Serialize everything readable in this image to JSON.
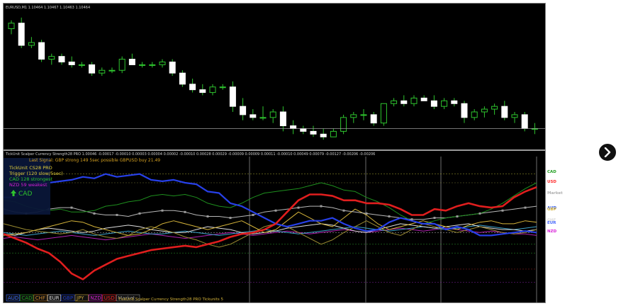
{
  "chart": {
    "symbol_header": "EURUSD,M1  1.10464 1.10467 1.10463 1.10464",
    "price_candles": [
      [
        1.1062,
        1.1065,
        1.106,
        1.1064
      ],
      [
        1.1064,
        1.1066,
        1.1055,
        1.1056
      ],
      [
        1.1056,
        1.1059,
        1.1055,
        1.1057
      ],
      [
        1.1057,
        1.1058,
        1.105,
        1.1051
      ],
      [
        1.1051,
        1.1053,
        1.1049,
        1.1052
      ],
      [
        1.1052,
        1.1053,
        1.1049,
        1.105
      ],
      [
        1.105,
        1.1052,
        1.1048,
        1.1049
      ],
      [
        1.1049,
        1.105,
        1.1048,
        1.1049
      ],
      [
        1.1049,
        1.105,
        1.1045,
        1.1046
      ],
      [
        1.1046,
        1.1048,
        1.1045,
        1.1047
      ],
      [
        1.1047,
        1.1048,
        1.1046,
        1.1047
      ],
      [
        1.1047,
        1.1052,
        1.1046,
        1.1051
      ],
      [
        1.1051,
        1.1053,
        1.1049,
        1.1049
      ],
      [
        1.1049,
        1.105,
        1.1048,
        1.1049
      ],
      [
        1.1049,
        1.105,
        1.1048,
        1.1049
      ],
      [
        1.1049,
        1.1051,
        1.1048,
        1.105
      ],
      [
        1.105,
        1.1051,
        1.1045,
        1.1046
      ],
      [
        1.1046,
        1.1047,
        1.1041,
        1.1042
      ],
      [
        1.1042,
        1.1044,
        1.1039,
        1.104
      ],
      [
        1.104,
        1.1042,
        1.1038,
        1.1039
      ],
      [
        1.1039,
        1.1042,
        1.1038,
        1.1041
      ],
      [
        1.1041,
        1.1042,
        1.104,
        1.1041
      ],
      [
        1.1041,
        1.1043,
        1.1032,
        1.1034
      ],
      [
        1.1034,
        1.1037,
        1.1029,
        1.1031
      ],
      [
        1.1031,
        1.1033,
        1.1029,
        1.103
      ],
      [
        1.103,
        1.1034,
        1.1029,
        1.103
      ],
      [
        1.103,
        1.1033,
        1.1028,
        1.1032
      ],
      [
        1.1032,
        1.1034,
        1.1025,
        1.1027
      ],
      [
        1.1027,
        1.1029,
        1.1024,
        1.1026
      ],
      [
        1.1026,
        1.1027,
        1.1024,
        1.1025
      ],
      [
        1.1025,
        1.1027,
        1.1023,
        1.1024
      ],
      [
        1.1024,
        1.1026,
        1.1022,
        1.1023
      ],
      [
        1.1023,
        1.1026,
        1.1023,
        1.1025
      ],
      [
        1.1025,
        1.1031,
        1.1024,
        1.103
      ],
      [
        1.103,
        1.1032,
        1.1028,
        1.1031
      ],
      [
        1.1031,
        1.1033,
        1.1029,
        1.1031
      ],
      [
        1.1031,
        1.1032,
        1.1027,
        1.1028
      ],
      [
        1.1028,
        1.1035,
        1.1027,
        1.1035
      ],
      [
        1.1035,
        1.1037,
        1.1034,
        1.1036
      ],
      [
        1.1036,
        1.1038,
        1.1034,
        1.1035
      ],
      [
        1.1035,
        1.1038,
        1.1034,
        1.1037
      ],
      [
        1.1037,
        1.1038,
        1.1036,
        1.1036
      ],
      [
        1.1036,
        1.1038,
        1.1033,
        1.1034
      ],
      [
        1.1034,
        1.1037,
        1.1033,
        1.1036
      ],
      [
        1.1036,
        1.1037,
        1.1034,
        1.1035
      ],
      [
        1.1035,
        1.1036,
        1.1028,
        1.103
      ],
      [
        1.103,
        1.1033,
        1.1029,
        1.1032
      ],
      [
        1.1032,
        1.1034,
        1.103,
        1.1033
      ],
      [
        1.1033,
        1.1035,
        1.1031,
        1.1034
      ],
      [
        1.1034,
        1.1036,
        1.1029,
        1.103
      ],
      [
        1.103,
        1.1032,
        1.1028,
        1.1031
      ],
      [
        1.1031,
        1.1032,
        1.1025,
        1.1026
      ],
      [
        1.1026,
        1.1028,
        1.1024,
        1.1026
      ]
    ],
    "price_range": [
      1.102,
      1.1068
    ],
    "current_price": 1.1026,
    "indicator_header": "TickUnit Scalper Currency Strength28 PRO 1.00046 -0.00017 -0.00010 0.00003 0.00004 0.00002 -0.00010 0.00028 0.00029 -0.00009 0.00009 0.00011 -0.00010 0.00049 0.00079 -0.00127 -0.00206 -0.00206",
    "info_panel": {
      "last_signal": "Last Signal: GBP strong 149 5sec possible GBPUSD buy 21.49",
      "line1": "TickUnit CS28 PRO",
      "line2": "Trigger (120 slow/5sec)",
      "line3": "CAD 128 strongest",
      "line4": "NZD 59 weakest",
      "arrow_label": "CAD"
    },
    "right_labels": [
      {
        "text": "CAD",
        "color": "#1e9e1e"
      },
      {
        "text": "USD",
        "color": "#ff2a2a"
      },
      {
        "text": "Market",
        "color": "#b0b0b0"
      },
      {
        "text": "AUD",
        "color": "#3a5fe6"
      },
      {
        "text": "GBP",
        "color": "#d4b33a"
      },
      {
        "text": "CHF",
        "color": "#e0e0e0"
      },
      {
        "text": "JPY",
        "color": "#e0e0e0"
      },
      {
        "text": "EUR",
        "color": "#4a6bff"
      },
      {
        "text": "NZD",
        "color": "#d81ed8"
      }
    ],
    "legend": [
      {
        "text": "AUD",
        "color": "#3a6bff"
      },
      {
        "text": "CAD",
        "color": "#1e9e1e"
      },
      {
        "text": "CHF",
        "color": "#d08a2a"
      },
      {
        "text": "EUR",
        "color": "#e0e0e0"
      },
      {
        "text": "GBP",
        "color": "#1a3ad0"
      },
      {
        "text": "JPY",
        "color": "#c7a53a"
      },
      {
        "text": "NZD",
        "color": "#d81ed8"
      },
      {
        "text": "USD",
        "color": "#ff2020"
      },
      {
        "text": "Market",
        "color": "#8a8a8a"
      }
    ],
    "footer_label": "TickUnit Scalper Currency Strength28 PRO  Tickunits 5",
    "strength_series": [
      {
        "name": "USD",
        "color": "#e01e1e",
        "width": 2.6,
        "values": [
          0.05,
          0.02,
          -0.01,
          -0.05,
          -0.08,
          -0.14,
          -0.22,
          -0.26,
          -0.2,
          -0.16,
          -0.12,
          -0.1,
          -0.08,
          -0.06,
          -0.05,
          -0.04,
          -0.03,
          -0.04,
          -0.02,
          0.0,
          0.03,
          0.05,
          0.06,
          0.08,
          0.12,
          0.2,
          0.28,
          0.32,
          0.32,
          0.31,
          0.28,
          0.28,
          0.26,
          0.26,
          0.25,
          0.22,
          0.18,
          0.18,
          0.22,
          0.21,
          0.24,
          0.26,
          0.24,
          0.23,
          0.24,
          0.3,
          0.34,
          0.37
        ]
      },
      {
        "name": "EUR",
        "color": "#2740e8",
        "width": 2.2,
        "values": [
          0.3,
          0.3,
          0.36,
          0.4,
          0.4,
          0.41,
          0.42,
          0.44,
          0.43,
          0.46,
          0.44,
          0.45,
          0.46,
          0.42,
          0.41,
          0.42,
          0.4,
          0.39,
          0.34,
          0.33,
          0.26,
          0.24,
          0.2,
          0.16,
          0.12,
          0.1,
          0.12,
          0.14,
          0.14,
          0.16,
          0.12,
          0.09,
          0.07,
          0.08,
          0.13,
          0.16,
          0.14,
          0.12,
          0.12,
          0.08,
          0.1,
          0.08,
          0.04,
          0.04,
          0.05,
          0.06,
          0.07,
          0.06
        ]
      },
      {
        "name": "CAD",
        "color": "#1e8f1e",
        "width": 1,
        "values": [
          0.28,
          0.27,
          0.24,
          0.22,
          0.21,
          0.22,
          0.2,
          0.2,
          0.21,
          0.24,
          0.25,
          0.27,
          0.28,
          0.31,
          0.32,
          0.31,
          0.32,
          0.3,
          0.26,
          0.24,
          0.23,
          0.26,
          0.3,
          0.33,
          0.34,
          0.35,
          0.36,
          0.38,
          0.4,
          0.38,
          0.35,
          0.34,
          0.3,
          0.27,
          0.23,
          0.18,
          0.14,
          0.12,
          0.14,
          0.16,
          0.17,
          0.18,
          0.19,
          0.22,
          0.26,
          0.31,
          0.36,
          0.4
        ]
      },
      {
        "name": "Market",
        "color": "#b8b8b8",
        "width": 1,
        "values": [
          0.22,
          0.2,
          0.19,
          0.2,
          0.22,
          0.23,
          0.23,
          0.21,
          0.19,
          0.18,
          0.18,
          0.17,
          0.19,
          0.2,
          0.21,
          0.21,
          0.2,
          0.18,
          0.17,
          0.17,
          0.16,
          0.17,
          0.18,
          0.2,
          0.21,
          0.22,
          0.23,
          0.24,
          0.24,
          0.23,
          0.21,
          0.2,
          0.19,
          0.18,
          0.17,
          0.16,
          0.15,
          0.15,
          0.16,
          0.16,
          0.17,
          0.18,
          0.19,
          0.2,
          0.21,
          0.22,
          0.23,
          0.24
        ]
      },
      {
        "name": "GBP",
        "color": "#d4b33a",
        "width": 1,
        "values": [
          0.04,
          0.05,
          0.06,
          0.08,
          0.1,
          0.12,
          0.14,
          0.13,
          0.1,
          0.08,
          0.06,
          0.04,
          0.05,
          0.08,
          0.12,
          0.14,
          0.12,
          0.1,
          0.08,
          0.1,
          0.12,
          0.14,
          0.1,
          0.06,
          0.08,
          0.14,
          0.2,
          0.16,
          0.12,
          0.1,
          0.16,
          0.22,
          0.18,
          0.12,
          0.08,
          0.1,
          0.12,
          0.14,
          0.12,
          0.1,
          0.08,
          0.11,
          0.13,
          0.14,
          0.12,
          0.12,
          0.14,
          0.13
        ]
      },
      {
        "name": "JPY",
        "color": "#9a8a30",
        "width": 1,
        "values": [
          0.12,
          0.1,
          0.08,
          0.07,
          0.06,
          0.05,
          0.06,
          0.08,
          0.05,
          0.03,
          0.02,
          0.04,
          0.08,
          0.1,
          0.08,
          0.06,
          0.03,
          0.01,
          -0.02,
          -0.04,
          -0.02,
          0.02,
          0.06,
          0.1,
          0.12,
          0.1,
          0.06,
          0.02,
          -0.02,
          0.01,
          0.06,
          0.1,
          0.14,
          0.1,
          0.06,
          0.04,
          0.08,
          0.12,
          0.1,
          0.08,
          0.06,
          0.08,
          0.1,
          0.08,
          0.06,
          0.05,
          0.06,
          0.08
        ]
      },
      {
        "name": "CHF",
        "color": "#dcdcdc",
        "width": 1,
        "values": [
          0.05,
          0.04,
          0.06,
          0.08,
          0.09,
          0.08,
          0.07,
          0.06,
          0.07,
          0.09,
          0.1,
          0.11,
          0.1,
          0.08,
          0.07,
          0.06,
          0.06,
          0.08,
          0.1,
          0.09,
          0.08,
          0.06,
          0.05,
          0.06,
          0.07,
          0.09,
          0.1,
          0.11,
          0.12,
          0.11,
          0.09,
          0.07,
          0.06,
          0.08,
          0.1,
          0.12,
          0.11,
          0.1,
          0.09,
          0.1,
          0.11,
          0.12,
          0.1,
          0.09,
          0.08,
          0.08,
          0.07,
          0.08
        ]
      },
      {
        "name": "AUD",
        "color": "#3aa0c8",
        "width": 1,
        "values": [
          0.06,
          0.05,
          0.04,
          0.05,
          0.06,
          0.07,
          0.06,
          0.05,
          0.04,
          0.05,
          0.06,
          0.07,
          0.06,
          0.05,
          0.05,
          0.06,
          0.07,
          0.06,
          0.05,
          0.04,
          0.05,
          0.06,
          0.07,
          0.08,
          0.07,
          0.06,
          0.05,
          0.06,
          0.07,
          0.08,
          0.09,
          0.1,
          0.09,
          0.08,
          0.07,
          0.08,
          0.09,
          0.1,
          0.09,
          0.08,
          0.09,
          0.1,
          0.11,
          0.1,
          0.09,
          0.08,
          0.09,
          0.1
        ]
      },
      {
        "name": "NZD",
        "color": "#b020b0",
        "width": 1,
        "values": [
          0.02,
          0.03,
          0.02,
          0.01,
          0.02,
          0.03,
          0.04,
          0.03,
          0.02,
          0.01,
          0.02,
          0.03,
          0.04,
          0.05,
          0.04,
          0.03,
          0.02,
          0.03,
          0.04,
          0.05,
          0.06,
          0.05,
          0.04,
          0.05,
          0.06,
          0.07,
          0.06,
          0.05,
          0.06,
          0.07,
          0.08,
          0.07,
          0.06,
          0.07,
          0.08,
          0.09,
          0.08,
          0.07,
          0.08,
          0.09,
          0.08,
          0.07,
          0.06,
          0.07,
          0.06,
          0.05,
          0.05,
          0.04
        ]
      }
    ],
    "strength_range": [
      -0.35,
      0.55
    ]
  },
  "nav": {
    "next_icon": "chevron-right-icon"
  }
}
